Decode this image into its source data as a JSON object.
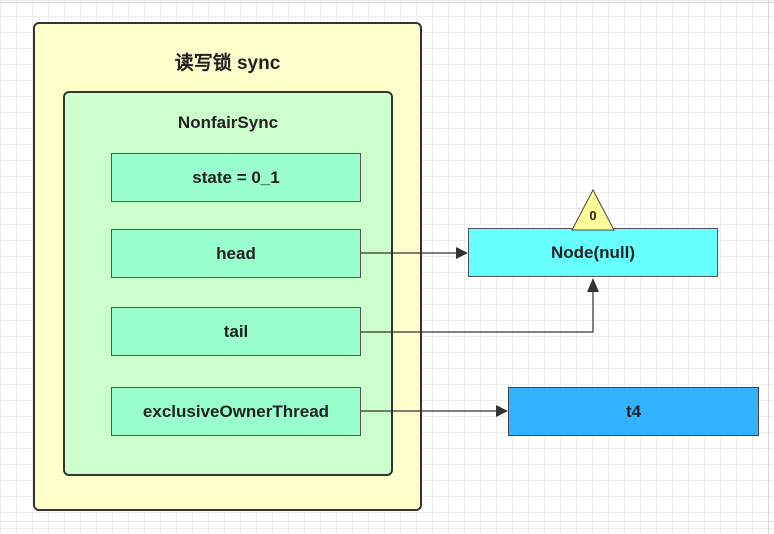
{
  "diagram": {
    "container_title": "读写锁 sync",
    "sync_title": "NonfairSync",
    "fields": {
      "state": "state = 0_1",
      "head": "head",
      "tail": "tail",
      "owner": "exclusiveOwnerThread"
    },
    "node_label": "Node(null)",
    "node_badge": "0",
    "thread_label": "t4"
  },
  "colors": {
    "outer_fill": "#ffffcc",
    "inner_fill": "#ccffcc",
    "field_fill": "#99ffcc",
    "node_fill": "#66ffff",
    "thread_fill": "#33b2ff",
    "badge_fill": "#ffff99"
  }
}
